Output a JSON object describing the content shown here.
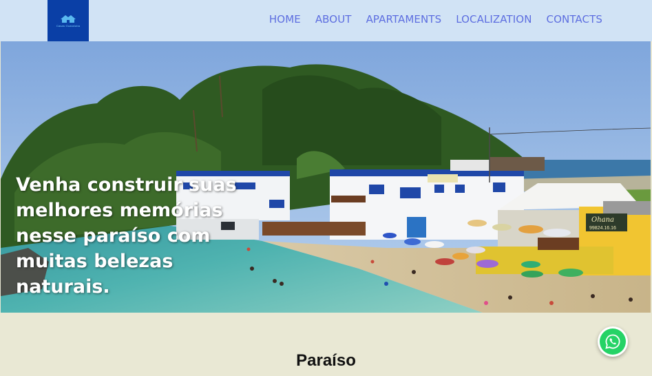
{
  "header": {
    "logo_text": "Casas Guaratuba",
    "nav": [
      "HOME",
      "ABOUT",
      "APARTAMENTS",
      "LOCALIZATION",
      "CONTACTS"
    ]
  },
  "hero": {
    "headline": "Venha construir suas melhores memórias nesse paraíso com muitas belezas naturais.",
    "sign_1": "Ohana",
    "sign_2": "99824.16.16"
  },
  "section": {
    "title": "Paraíso"
  },
  "colors": {
    "header_bg": "#d1e3f5",
    "logo_bg": "#0a3fa6",
    "nav_text": "#5d6ee0",
    "page_bg": "#e9e8d4",
    "whatsapp": "#25d366"
  },
  "icons": {
    "logo": "house-logo-icon",
    "whatsapp": "whatsapp-icon"
  }
}
